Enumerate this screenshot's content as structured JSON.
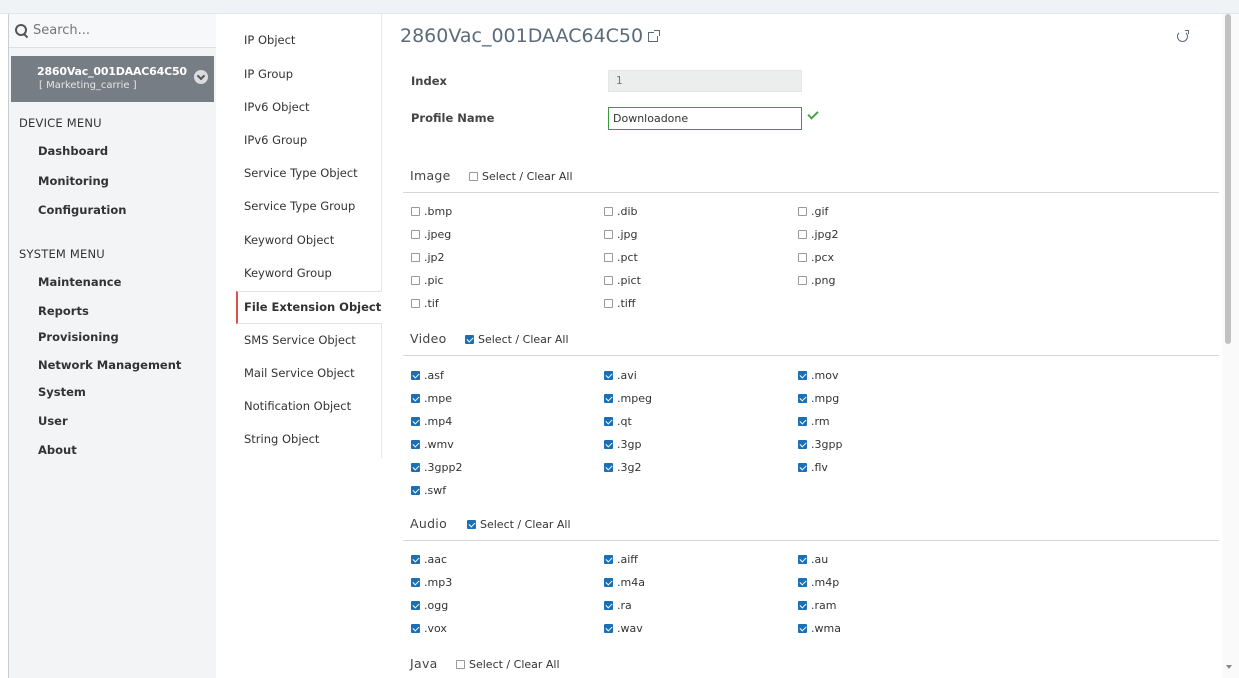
{
  "search": {
    "placeholder": "Search..."
  },
  "device": {
    "name": "2860Vac_001DAAC64C50",
    "sub": "[ Marketing_carrie ]"
  },
  "device_menu": {
    "heading": "DEVICE MENU",
    "items": [
      "Dashboard",
      "Monitoring",
      "Configuration"
    ]
  },
  "system_menu": {
    "heading": "SYSTEM MENU",
    "items": [
      "Maintenance",
      "Reports",
      "Provisioning",
      "Network Management",
      "System",
      "User",
      "About"
    ]
  },
  "objects": {
    "items": [
      "IP Object",
      "IP Group",
      "IPv6 Object",
      "IPv6 Group",
      "Service Type Object",
      "Service Type Group",
      "Keyword Object",
      "Keyword Group",
      "File Extension Object",
      "SMS Service Object",
      "Mail Service Object",
      "Notification Object",
      "String Object"
    ],
    "active": "File Extension Object"
  },
  "main": {
    "title": "2860Vac_001DAAC64C50",
    "index_label": "Index",
    "index_value": "1",
    "profile_label": "Profile Name",
    "profile_value": "Downloadone"
  },
  "select_all_label": "Select / Clear All",
  "sections": {
    "image": {
      "title": "Image",
      "all": false,
      "options": [
        ".bmp",
        ".dib",
        ".gif",
        ".jpeg",
        ".jpg",
        ".jpg2",
        ".jp2",
        ".pct",
        ".pcx",
        ".pic",
        ".pict",
        ".png",
        ".tif",
        ".tiff"
      ]
    },
    "video": {
      "title": "Video",
      "all": true,
      "options": [
        ".asf",
        ".avi",
        ".mov",
        ".mpe",
        ".mpeg",
        ".mpg",
        ".mp4",
        ".qt",
        ".rm",
        ".wmv",
        ".3gp",
        ".3gpp",
        ".3gpp2",
        ".3g2",
        ".flv",
        ".swf"
      ]
    },
    "audio": {
      "title": "Audio",
      "all": true,
      "options": [
        ".aac",
        ".aiff",
        ".au",
        ".mp3",
        ".m4a",
        ".m4p",
        ".ogg",
        ".ra",
        ".ram",
        ".vox",
        ".wav",
        ".wma"
      ]
    },
    "java": {
      "title": "Java",
      "all": false,
      "options": []
    }
  },
  "colors": {
    "accent": "#1a6fb5",
    "active_marker": "#d9534f",
    "valid": "#46a546",
    "device_bg": "#777d85"
  }
}
